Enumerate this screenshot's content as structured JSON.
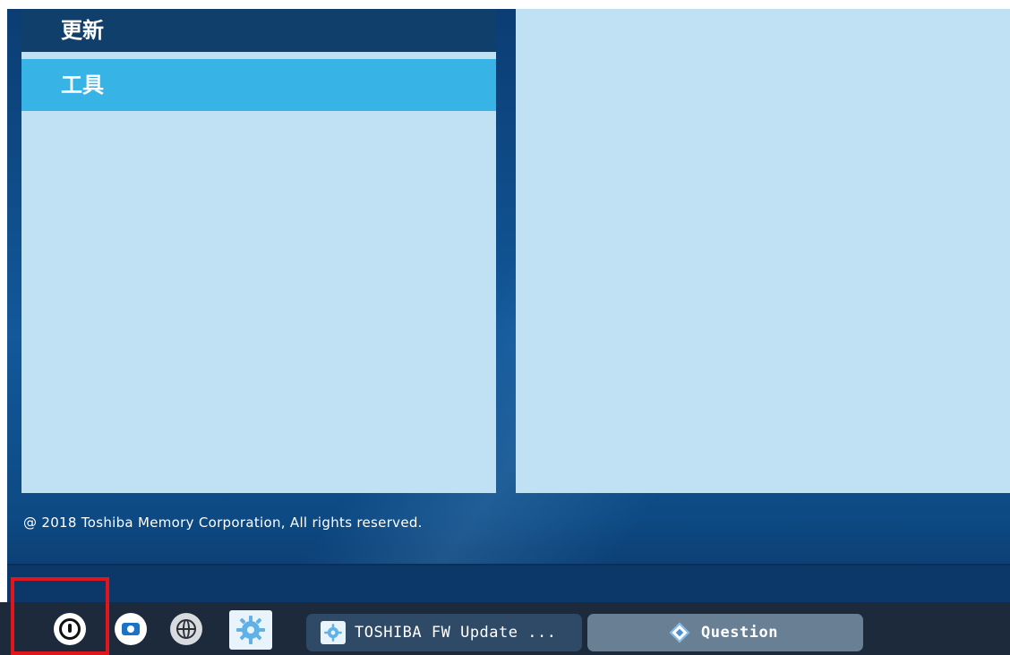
{
  "menu": {
    "items": [
      {
        "label": "更新"
      },
      {
        "label": "工具"
      }
    ]
  },
  "footer": {
    "copyright": "@ 2018 Toshiba Memory Corporation, All rights reserved."
  },
  "taskbar": {
    "icons": [
      "power-icon",
      "camera-icon",
      "globe-icon",
      "gear-icon"
    ],
    "tasks": [
      {
        "label": "TOSHIBA FW Update ..."
      },
      {
        "label": "Question"
      }
    ]
  },
  "colors": {
    "menu_selected": "#37b3e6",
    "menu_item": "#113f6b",
    "panel": "#c0e1f4",
    "highlight_box": "#e1151c"
  }
}
